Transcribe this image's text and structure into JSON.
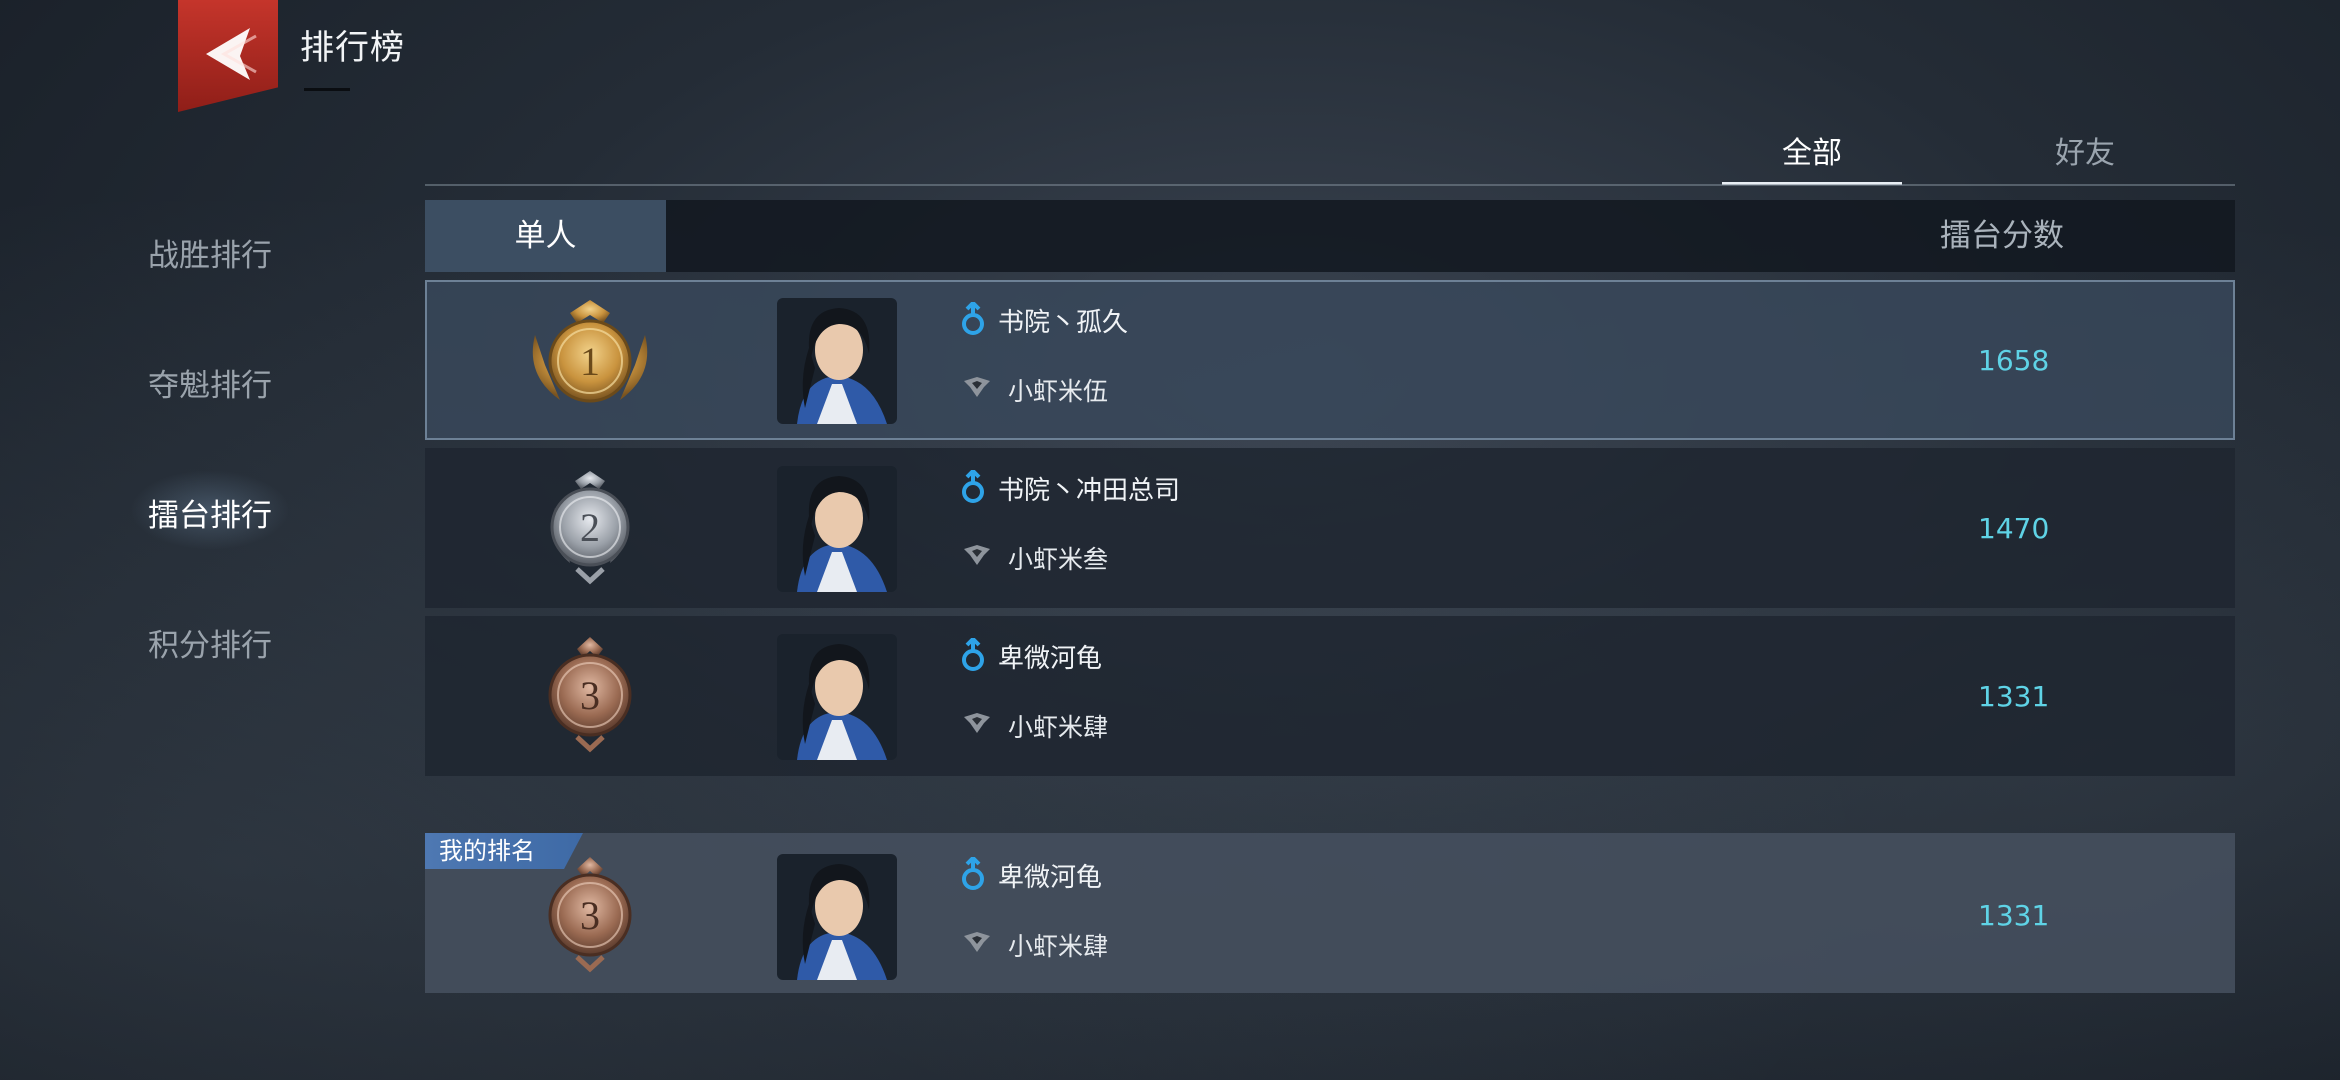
{
  "header": {
    "title": "排行榜"
  },
  "scope_tabs": [
    {
      "label": "全部",
      "active": true
    },
    {
      "label": "好友",
      "active": false
    }
  ],
  "sidebar": [
    {
      "label": "战胜排行",
      "active": false
    },
    {
      "label": "夺魁排行",
      "active": false
    },
    {
      "label": "擂台排行",
      "active": true
    },
    {
      "label": "积分排行",
      "active": false
    }
  ],
  "table": {
    "mode_tab": "单人",
    "score_header": "擂台分数"
  },
  "rows": [
    {
      "rank": "1",
      "medal": "gold",
      "name": "书院丶孤久",
      "guild": "小虾米伍",
      "score": "1658"
    },
    {
      "rank": "2",
      "medal": "silver",
      "name": "书院丶冲田总司",
      "guild": "小虾米叁",
      "score": "1470"
    },
    {
      "rank": "3",
      "medal": "bronze",
      "name": "卑微河龟",
      "guild": "小虾米肆",
      "score": "1331"
    }
  ],
  "my_rank": {
    "tag": "我的排名",
    "rank": "3",
    "medal": "bronze",
    "name": "卑微河龟",
    "guild": "小虾米肆",
    "score": "1331"
  },
  "colors": {
    "score": "#5fd3e6",
    "gender_male": "#2ea3e8",
    "back_button": "#c5352b",
    "gold": "#c9933e",
    "silver": "#9aa0a8",
    "bronze": "#9a6a52"
  },
  "icons": {
    "back": "back-chevron-icon",
    "gender": "male-icon",
    "guild": "guild-emblem-icon",
    "portrait": "character-portrait",
    "rank_medal": "rank-medal-icon"
  }
}
